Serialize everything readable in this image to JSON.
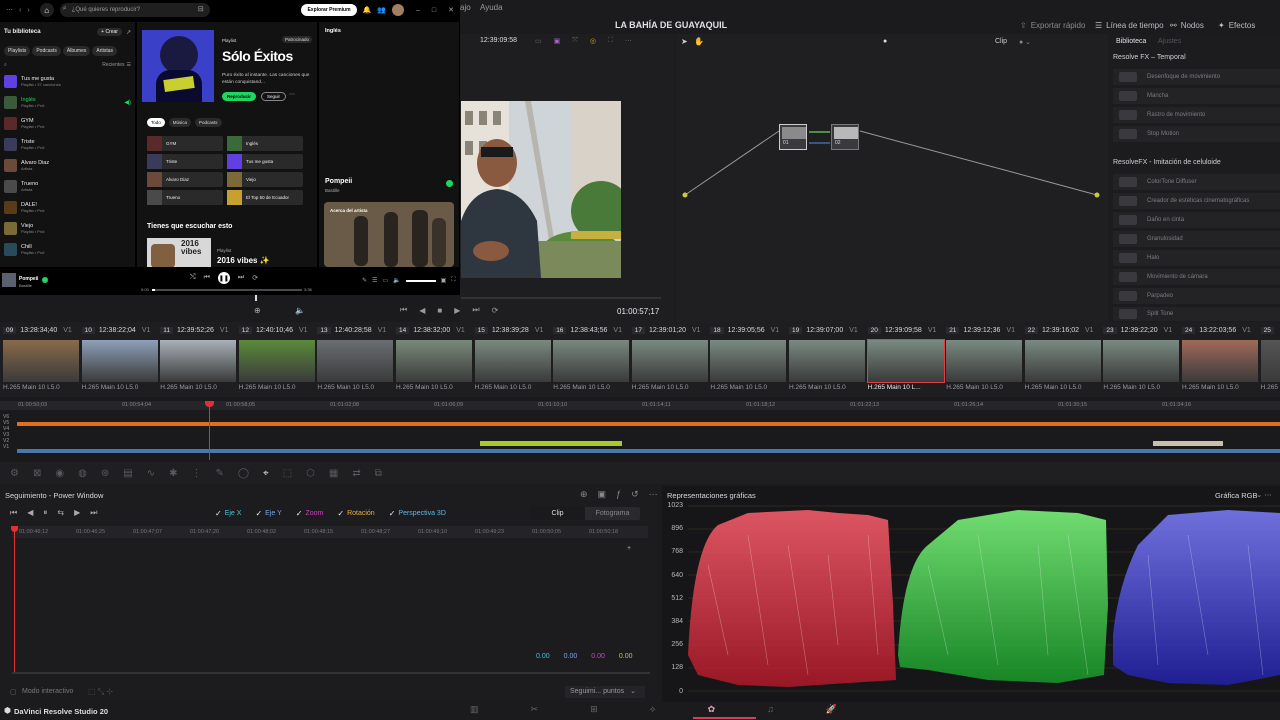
{
  "menu": {
    "partial_left": "ajo",
    "help": "Ayuda"
  },
  "project_title": "LA BAHÍA DE GUAYAQUIL",
  "top_right": [
    {
      "icon": "quick-export-icon",
      "label": "Exportar rápido"
    },
    {
      "icon": "timeline-icon",
      "label": "Línea de tiempo"
    },
    {
      "icon": "nodes-icon",
      "label": "Nodos"
    },
    {
      "icon": "effects-icon",
      "label": "Efectos"
    }
  ],
  "viewer": {
    "timecode_top": "12:39:09:58",
    "timecode_bottom": "01:00:57;17"
  },
  "node_editor": {
    "mode": "Clip",
    "node1_label": "01",
    "node2_label": "02"
  },
  "library": {
    "tab_active": "Biblioteca",
    "tab_inactive": "Ajustes",
    "section1": "Resolve FX – Temporal",
    "section1_items": [
      "Desenfoque de movimiento",
      "Mancha",
      "Rastro de movimiento",
      "Stop Motion"
    ],
    "section2": "ResolveFX - Imitación de celuloide",
    "section2_items": [
      "ColorTone Diffuser",
      "Creador de estéticas cinematográficas",
      "Daño en cinta",
      "Granulosidad",
      "Halo",
      "Movimiento de cámara",
      "Parpadeo",
      "Split Tone"
    ]
  },
  "clips": [
    {
      "num": "09",
      "tc": "13:28:34;40",
      "track": "V1",
      "color": "#8a6a4a"
    },
    {
      "num": "10",
      "tc": "12:38:22;04",
      "track": "V1",
      "color": "#8ea0b8"
    },
    {
      "num": "11",
      "tc": "12:39:52;26",
      "track": "V1",
      "color": "#a8b0b8"
    },
    {
      "num": "12",
      "tc": "12:40:10;46",
      "track": "V1",
      "color": "#5a8a3a"
    },
    {
      "num": "13",
      "tc": "12:40:28;58",
      "track": "V1",
      "color": "#6a6e72"
    },
    {
      "num": "14",
      "tc": "12:38:32;00",
      "track": "V1",
      "color": "#7a8a7a"
    },
    {
      "num": "15",
      "tc": "12:38:39;28",
      "track": "V1",
      "color": "#7a8a80"
    },
    {
      "num": "16",
      "tc": "12:38:43;56",
      "track": "V1",
      "color": "#7a8880"
    },
    {
      "num": "17",
      "tc": "12:39:01;20",
      "track": "V1",
      "color": "#7a8a82"
    },
    {
      "num": "18",
      "tc": "12:39:05;56",
      "track": "V1",
      "color": "#7a8a82"
    },
    {
      "num": "19",
      "tc": "12:39:07;00",
      "track": "V1",
      "color": "#7a8a82"
    },
    {
      "num": "20",
      "tc": "12:39:09;58",
      "track": "V1",
      "color": "#7a8a82"
    },
    {
      "num": "21",
      "tc": "12:39:12;36",
      "track": "V1",
      "color": "#7a8a82"
    },
    {
      "num": "22",
      "tc": "12:39:16;02",
      "track": "V1",
      "color": "#7a8a82"
    },
    {
      "num": "23",
      "tc": "12:39:22;20",
      "track": "V1",
      "color": "#7a8a82"
    },
    {
      "num": "24",
      "tc": "13:22:03;56",
      "track": "V1",
      "color": "#a06a5a"
    },
    {
      "num": "25",
      "tc": "",
      "track": "",
      "color": "#555"
    }
  ],
  "clip_codec": "H.265 Main 10 L5.0",
  "clip_codec_selected": "H.265 Main 10 L...",
  "ruler_ticks": [
    "01:00:50;03",
    "01:00:54;04",
    "01:00:58;05",
    "01:01:02;08",
    "01:01:06;09",
    "01:01:10;10",
    "01:01:14;11",
    "01:01:18;12",
    "01:01:22;13",
    "01:01:26;14",
    "01:01:30;15",
    "01:01:34;16"
  ],
  "tracks": [
    "V6",
    "V5",
    "V4",
    "V3",
    "V2",
    "V1"
  ],
  "tracker": {
    "title": "Seguimiento - Power Window",
    "checks": [
      {
        "label": "Eje X",
        "color": "#3fc3d8"
      },
      {
        "label": "Eje Y",
        "color": "#7aa0e8"
      },
      {
        "label": "Zoom",
        "color": "#d040c0"
      },
      {
        "label": "Rotación",
        "color": "#e8b040"
      },
      {
        "label": "Perspectiva 3D",
        "color": "#60b8e8"
      }
    ],
    "tab_clip": "Clip",
    "tab_frame": "Fotograma",
    "ticks": [
      "01:00:46;12",
      "01:00:46;25",
      "01:00:47;07",
      "01:00:47;20",
      "01:00:48;02",
      "01:00:48;15",
      "01:00:48;27",
      "01:00:49;10",
      "01:00:49;23",
      "01:00:50;05",
      "01:00:50;18"
    ],
    "values": [
      {
        "v": "0.00",
        "color": "#3fc3d8"
      },
      {
        "v": "0.00",
        "color": "#7aa0e8"
      },
      {
        "v": "0.00",
        "color": "#d040c0"
      },
      {
        "v": "0.00",
        "color": "#e8b040"
      }
    ],
    "interactive_mode": "Modo interactivo",
    "track_dropdown": "Seguimi... puntos"
  },
  "scopes": {
    "title": "Representaciones gráficas",
    "mode": "Gráfica RGB",
    "labels": [
      "1023",
      "896",
      "768",
      "640",
      "512",
      "384",
      "256",
      "128",
      "0"
    ]
  },
  "app_name": "DaVinci Resolve Studio 20",
  "spotify": {
    "search_placeholder": "¿Qué quieres reproducir?",
    "premium": "Explorar Premium",
    "library": "Tu biblioteca",
    "create": "+ Crear",
    "chips": [
      "Playlists",
      "Podcasts",
      "Álbumes",
      "Artistas"
    ],
    "recent": "Recientes",
    "items": [
      {
        "t": "Tus me gusta",
        "s": "Playlist • 37 canciones",
        "c": "#6040e0"
      },
      {
        "t": "Inglés",
        "s": "Playlist • Pról",
        "c": "#3a5a3a",
        "green": true
      },
      {
        "t": "GYM",
        "s": "Playlist • Pról",
        "c": "#5a2a2a"
      },
      {
        "t": "Triste",
        "s": "Playlist • Pról",
        "c": "#3a3a5a"
      },
      {
        "t": "Alvaro Diaz",
        "s": "Artista",
        "c": "#6a4a3a"
      },
      {
        "t": "Trueno",
        "s": "Artista",
        "c": "#4a4a4a"
      },
      {
        "t": "DALE!",
        "s": "Playlist • Pról",
        "c": "#5a3a1a"
      },
      {
        "t": "Viejo",
        "s": "Playlist • Pról",
        "c": "#7a6a3a"
      },
      {
        "t": "Chill",
        "s": "Playlist • Pról",
        "c": "#2a4a5a"
      }
    ],
    "playlist_tag": "Playlist",
    "playlist_title": "Sólo Éxitos",
    "playlist_desc": "Puro éxito al instante. Las canciones que están conquistand...",
    "badge": "Patrocinado",
    "play_btn": "Reproducir",
    "follow_btn": "Seguir",
    "filters": [
      "Todo",
      "Música",
      "Podcasts"
    ],
    "grid": [
      "GYM",
      "Inglés",
      "Triste",
      "Tus me gusta",
      "Alvaro Diaz",
      "Viejo",
      "Trueno",
      "El Top 50 de Ecuador"
    ],
    "section": "Tienes que escuchar esto",
    "rec_tag": "Playlist",
    "rec_title": "2016 vibes ✨",
    "rec_cover": "2016 vibes",
    "right_header": "Inglés",
    "right_song": "Pompeii",
    "right_artist": "Bastille",
    "about": "Acerca del artista",
    "now_title": "Pompeii",
    "now_artist": "Bastille",
    "time_start": "0:03",
    "time_end": "3:35"
  }
}
